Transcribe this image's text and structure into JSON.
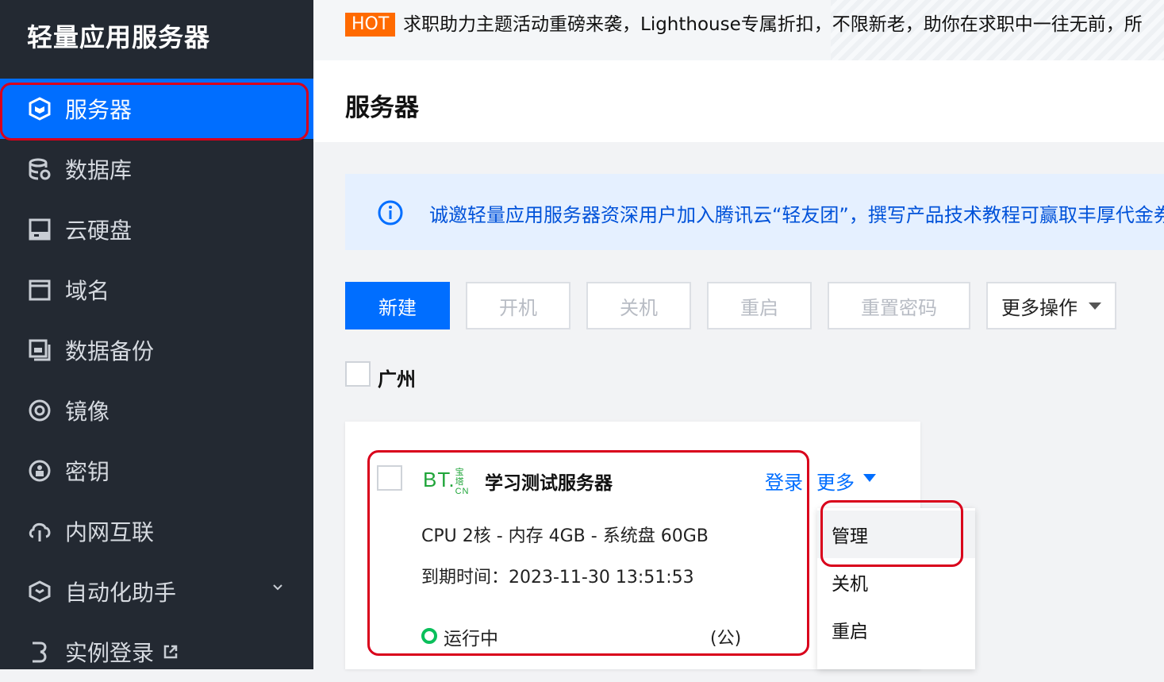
{
  "sidebar": {
    "title": "轻量应用服务器",
    "items": [
      {
        "label": "服务器",
        "icon": "cube-icon",
        "active": true
      },
      {
        "label": "数据库",
        "icon": "database-icon"
      },
      {
        "label": "云硬盘",
        "icon": "disk-icon"
      },
      {
        "label": "域名",
        "icon": "domain-icon"
      },
      {
        "label": "数据备份",
        "icon": "backup-icon"
      },
      {
        "label": "镜像",
        "icon": "image-icon"
      },
      {
        "label": "密钥",
        "icon": "key-icon"
      },
      {
        "label": "内网互联",
        "icon": "network-icon"
      },
      {
        "label": "自动化助手",
        "icon": "automation-icon",
        "expandable": true
      },
      {
        "label": "实例登录",
        "icon": "login-icon",
        "external": true
      }
    ]
  },
  "banner": {
    "badge": "HOT",
    "text": "求职助力主题活动重磅来袭，Lighthouse专属折扣，不限新老，助你在求职中一往无前，所"
  },
  "page": {
    "title": "服务器"
  },
  "notice": {
    "text": "诚邀轻量应用服务器资深用户加入腾讯云“轻友团”，撰写产品技术教程可赢取丰厚代金券"
  },
  "toolbar": {
    "new": "新建",
    "start": "开机",
    "stop": "关机",
    "restart": "重启",
    "reset_password": "重置密码",
    "more_actions": "更多操作"
  },
  "region": {
    "label": "广州"
  },
  "server": {
    "logo_text": "BT",
    "logo_dot": ".",
    "logo_sub": "宝塔CN",
    "name": "学习测试服务器",
    "login": "登录",
    "more": "更多",
    "spec": "CPU 2核 - 内存 4GB - 系统盘 60GB",
    "expiry": "到期时间：2023-11-30 13:51:53",
    "status": "运行中",
    "ip_type": "(公)"
  },
  "dropdown": {
    "items": [
      "管理",
      "关机",
      "重启"
    ]
  },
  "colors": {
    "sidebar_bg": "#232932",
    "primary": "#006eff",
    "highlight_red": "#d9001b",
    "running_green": "#0abf5b",
    "hot_orange": "#ff6a00"
  }
}
